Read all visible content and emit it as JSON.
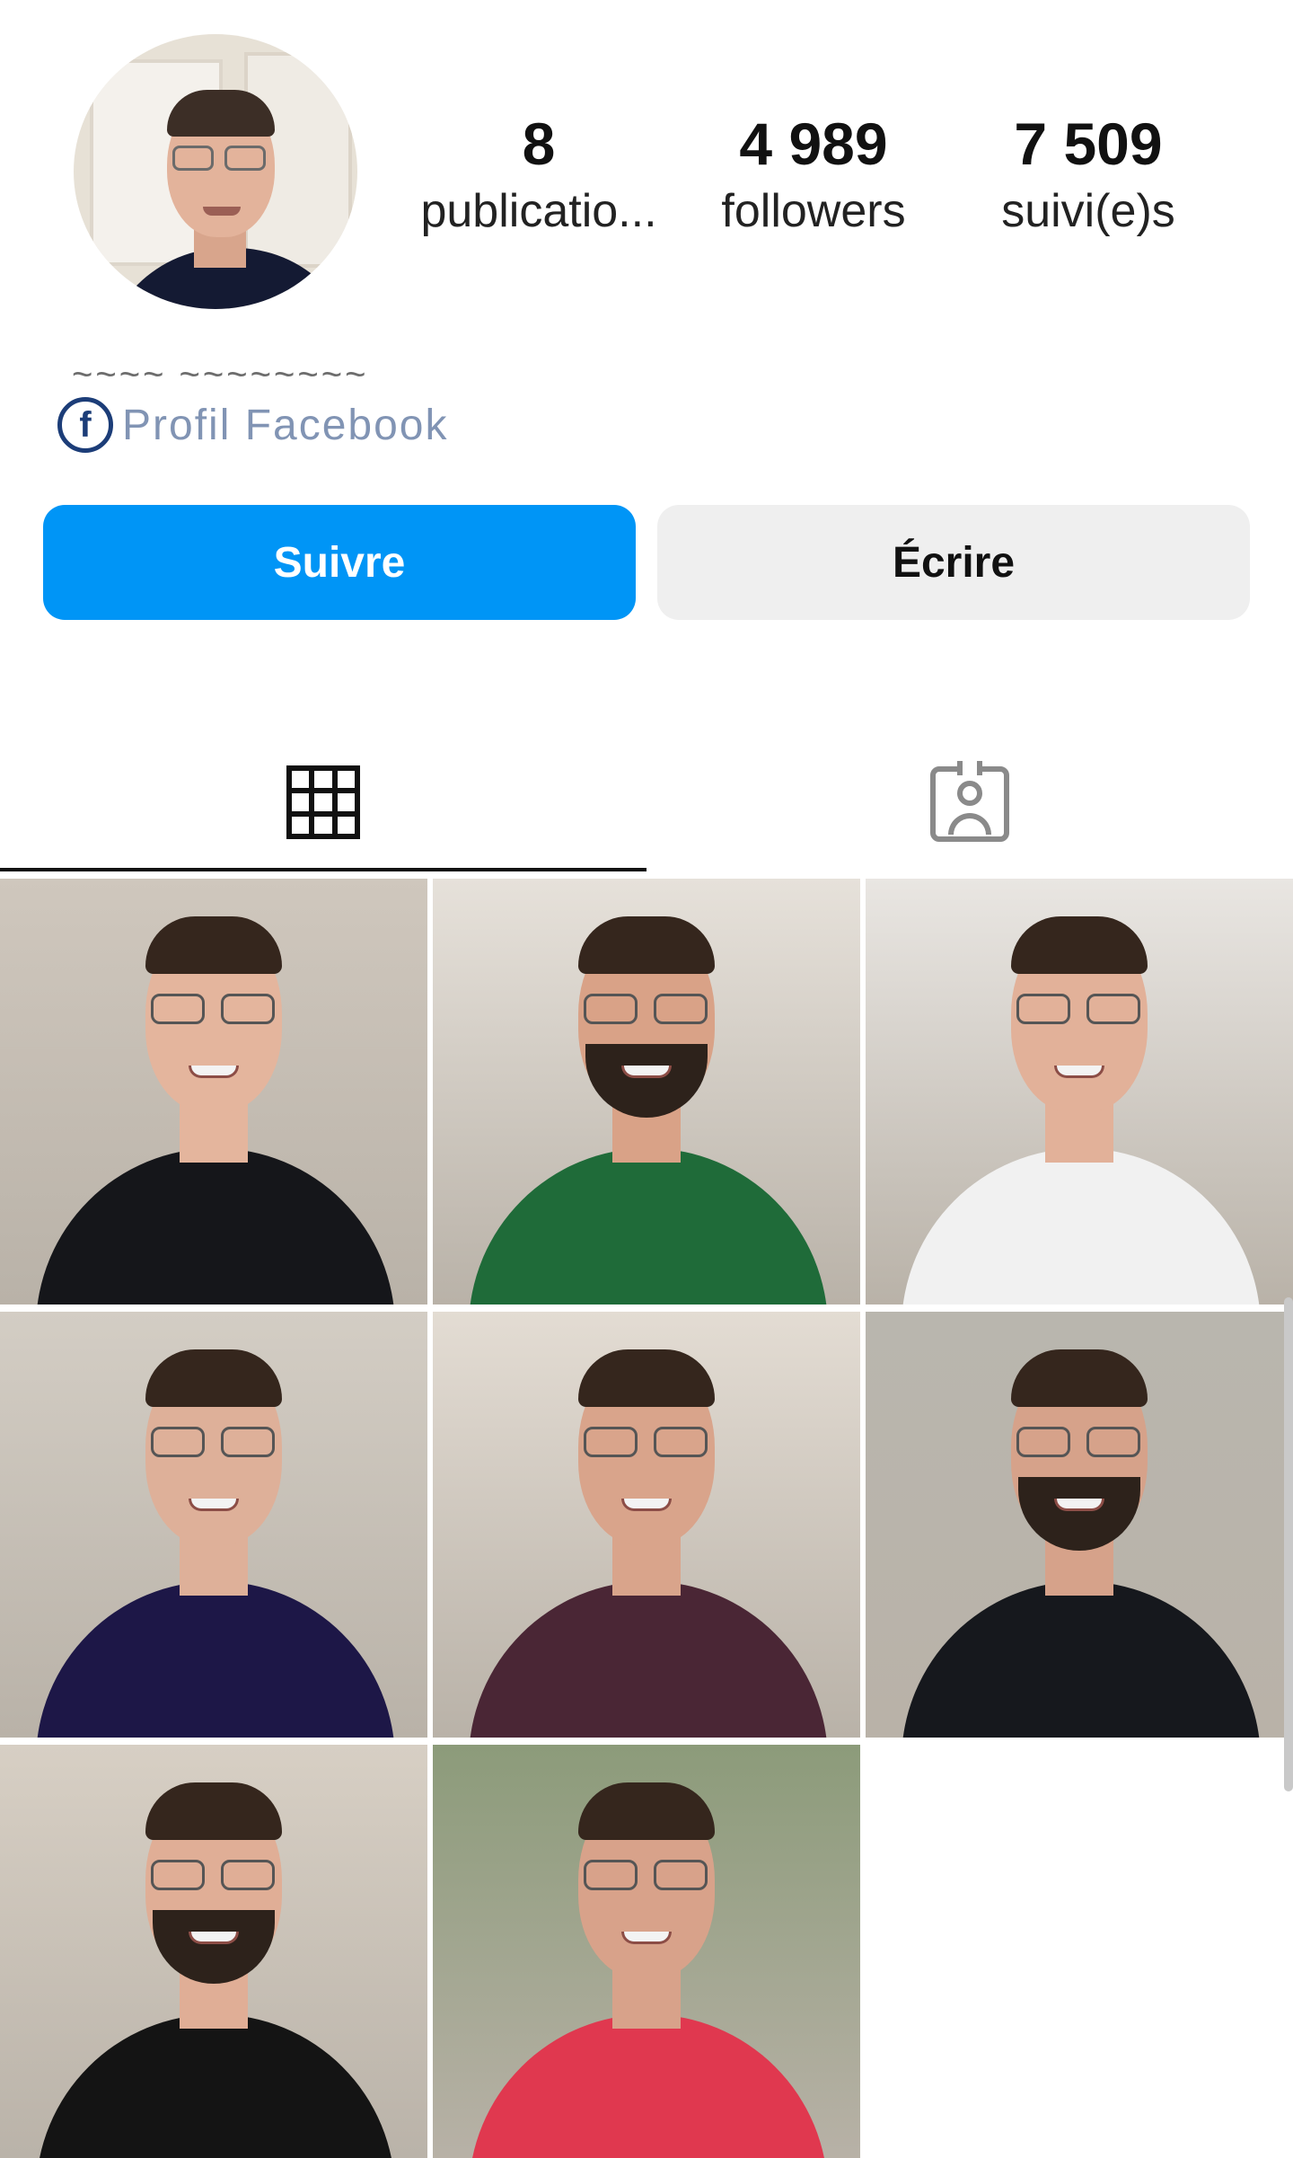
{
  "profile": {
    "name_obscured": "~~~~ ~~~~~~~~",
    "facebook_link_label": "Profil Facebook",
    "stats": [
      {
        "value": "8",
        "label": "publicatio..."
      },
      {
        "value": "4 989",
        "label": "followers"
      },
      {
        "value": "7 509",
        "label": "suivi(e)s"
      }
    ]
  },
  "actions": {
    "follow_label": "Suivre",
    "message_label": "Écrire"
  },
  "tabs": [
    {
      "icon": "grid-icon",
      "selected": true
    },
    {
      "icon": "tagged-user-icon",
      "selected": false
    }
  ],
  "posts": [
    {
      "bg": "#cfc7bd",
      "shirt": "#15161a",
      "skin": "#e4b59d"
    },
    {
      "bg": "#e6e1da",
      "shirt": "#1f6b39",
      "skin": "#d9a287"
    },
    {
      "bg": "#e9e6e2",
      "shirt": "#f1f1f1",
      "skin": "#e2b199"
    },
    {
      "bg": "#d3cdc4",
      "shirt": "#1d1747",
      "skin": "#deb099"
    },
    {
      "bg": "#e3dcd3",
      "shirt": "#4a2635",
      "skin": "#d9a48b"
    },
    {
      "bg": "#b9b6ae",
      "shirt": "#16181d",
      "skin": "#d6a28a"
    },
    {
      "bg": "#d7cfc4",
      "shirt": "#141414",
      "skin": "#e0ae96"
    },
    {
      "bg": "#8c9b7a",
      "shirt": "#e0384f",
      "skin": "#d8a28a"
    }
  ],
  "colors": {
    "accent": "#0095f6",
    "facebook": "#1c3d78",
    "secondary_button": "#efefef"
  }
}
